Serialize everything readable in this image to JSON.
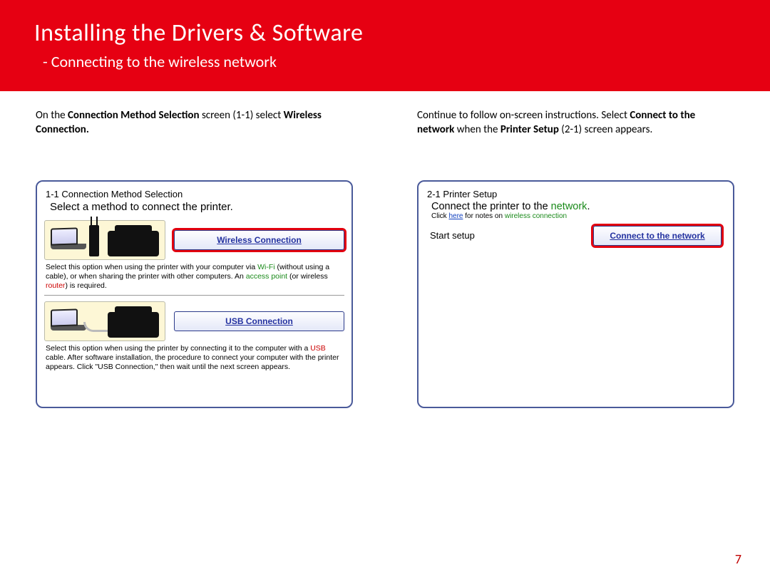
{
  "header": {
    "title": "Installing  the Drivers & Software",
    "subtitle": "- Connecting  to the wireless network"
  },
  "left": {
    "intro_prefix": "On the ",
    "intro_bold1": "Connection Method Selection",
    "intro_mid": " screen (1-1) select ",
    "intro_bold2": "Wireless Connection.",
    "dlg_title": "1-1 Connection Method Selection",
    "dlg_subtitle": "Select a method to connect the printer.",
    "wireless_btn": "Wireless Connection",
    "wireless_desc_pre": "Select this option when using the printer with your computer via ",
    "wifi_word": "Wi-Fi",
    "wireless_desc_mid": " (without using a cable), or when sharing the printer with other computers. An ",
    "access_point": "access point",
    "wireless_desc_mid2": " (or wireless ",
    "router_word": "router",
    "wireless_desc_end": ") is required.",
    "usb_btn": "USB Connection",
    "usb_desc_pre": "Select this option when using the printer by connecting it to the computer with a ",
    "usb_word": "USB",
    "usb_desc_end": " cable. After software installation, the procedure to connect your computer with the printer appears. Click \"USB Connection,\" then wait until the next screen appears."
  },
  "right": {
    "intro_prefix": "Continue to follow on-screen instructions. Select ",
    "intro_bold1": "Connect to the network",
    "intro_mid": " when the ",
    "intro_bold2": "Printer Setup",
    "intro_end": " (2-1) screen appears.",
    "dlg_title": "2-1 Printer Setup",
    "sub_pre": "Connect the printer to the ",
    "sub_green": "network",
    "sub_end": ".",
    "notes_pre": "Click ",
    "notes_link": "here",
    "notes_mid": " for notes on ",
    "notes_green": "wireless connection",
    "row_label": "Start setup",
    "row_btn": "Connect to the network"
  },
  "page_number": "7"
}
